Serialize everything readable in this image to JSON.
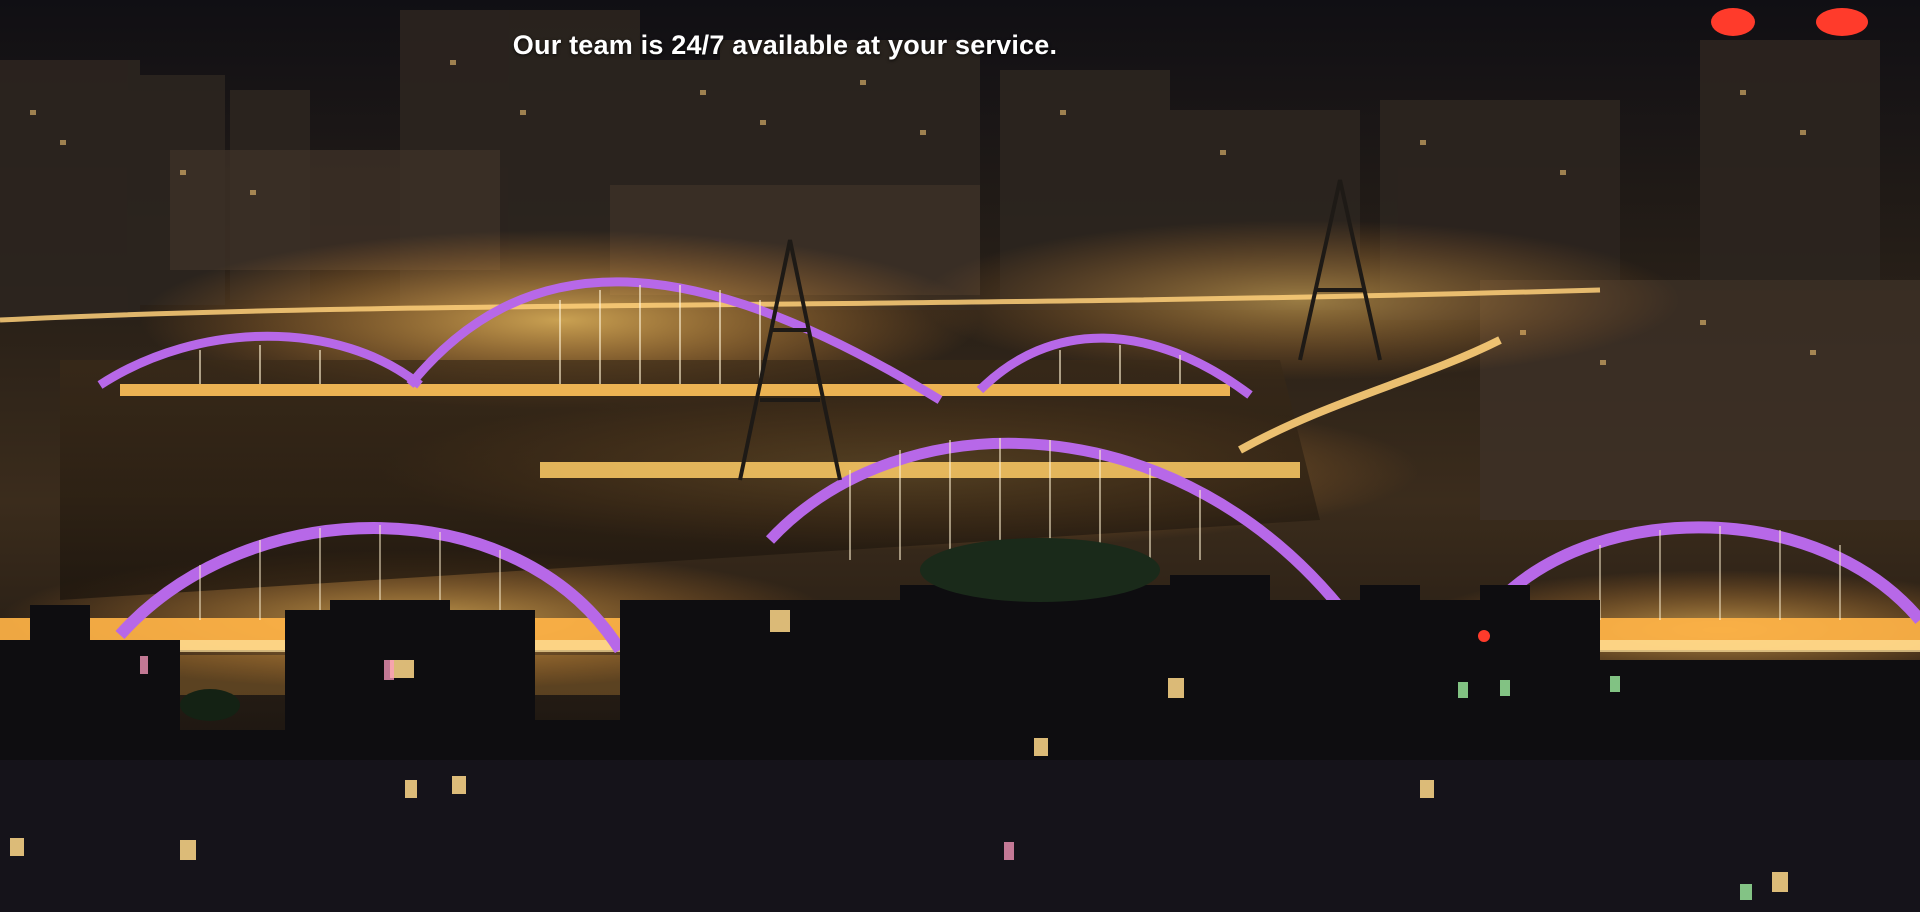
{
  "hero": {
    "headline": "Our team is 24/7 available at your service."
  },
  "colors": {
    "arch": "#b768e8",
    "lights": "#ffb347",
    "sky": "#0b0a0f"
  }
}
